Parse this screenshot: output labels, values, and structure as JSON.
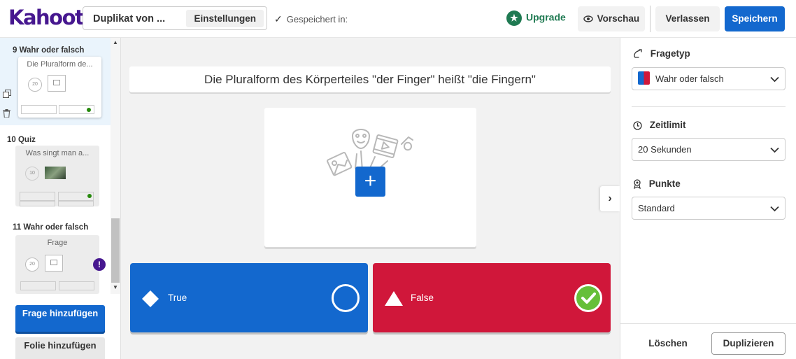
{
  "header": {
    "logo": "Kahoot!",
    "kahoot_title": "Duplikat von ...",
    "settings_label": "Einstellungen",
    "saved_label": "Gespeichert in:",
    "upgrade_label": "Upgrade",
    "preview_label": "Vorschau",
    "leave_label": "Verlassen",
    "save_label": "Speichern"
  },
  "sidebar": {
    "slides": [
      {
        "number_type": "9  Wahr oder falsch",
        "title": "Die Pluralform de...",
        "timer": "20",
        "selected": true,
        "media": "placeholder",
        "has_correct": true
      },
      {
        "number_type": "10  Quiz",
        "title": "Was singt man a...",
        "timer": "10",
        "selected": false,
        "media": "photo",
        "has_correct": true
      },
      {
        "number_type": "11  Wahr oder falsch",
        "title": "Frage",
        "timer": "20",
        "selected": false,
        "media": "placeholder",
        "warning": "!"
      }
    ],
    "add_question_label": "Frage hinzufügen",
    "add_slide_label": "Folie hinzufügen"
  },
  "editor": {
    "question": "Die Pluralform des Körperteiles \"der Finger\" heißt \"die Fingern\"",
    "add_media_symbol": "+",
    "answers": [
      {
        "label": "True",
        "shape": "diamond",
        "color": "#1368ce",
        "correct": false
      },
      {
        "label": "False",
        "shape": "triangle",
        "color": "#d0173a",
        "correct": true
      }
    ]
  },
  "right_panel": {
    "question_type_heading": "Fragetyp",
    "question_type_value": "Wahr oder falsch",
    "time_limit_heading": "Zeitlimit",
    "time_limit_value": "20 Sekunden",
    "points_heading": "Punkte",
    "points_value": "Standard",
    "delete_label": "Löschen",
    "duplicate_label": "Duplizieren"
  },
  "colors": {
    "brand_purple": "#46178f",
    "primary_blue": "#1368ce",
    "answer_red": "#d0173a",
    "correct_green": "#66bf39",
    "upgrade_green": "#1f7a52"
  }
}
